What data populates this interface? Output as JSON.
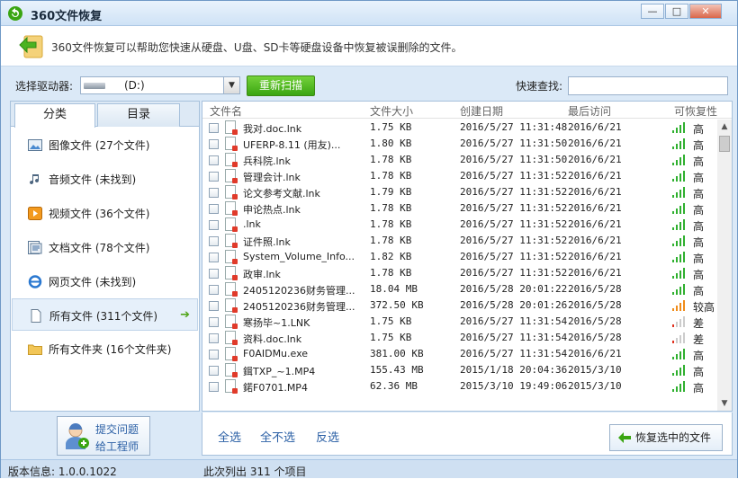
{
  "window": {
    "title": "360文件恢复",
    "min_label": "—",
    "max_label": "□",
    "close_label": "✕"
  },
  "banner": {
    "text": "360文件恢复可以帮助您快速从硬盘、U盘、SD卡等硬盘设备中恢复被误删除的文件。"
  },
  "toolbar": {
    "drive_label": "选择驱动器:",
    "drive_value": "(D:)",
    "scan_label": "重新扫描",
    "search_label": "快速查找:",
    "search_value": ""
  },
  "tabs": [
    {
      "label": "分类",
      "active": true
    },
    {
      "label": "目录",
      "active": false
    }
  ],
  "categories": [
    {
      "label": "图像文件 (27个文件)",
      "icon": "image-icon"
    },
    {
      "label": "音频文件 (未找到)",
      "icon": "music-icon"
    },
    {
      "label": "视频文件 (36个文件)",
      "icon": "video-icon"
    },
    {
      "label": "文档文件 (78个文件)",
      "icon": "document-icon"
    },
    {
      "label": "网页文件 (未找到)",
      "icon": "ie-icon"
    },
    {
      "label": "所有文件 (311个文件)",
      "icon": "file-icon",
      "active": true
    },
    {
      "label": "所有文件夹 (16个文件夹)",
      "icon": "folder-icon"
    }
  ],
  "help": {
    "line1": "提交问题",
    "line2": "给工程师"
  },
  "table": {
    "headers": {
      "name": "文件名",
      "size": "文件大小",
      "created": "创建日期",
      "accessed": "最后访问",
      "recover": "可恢复性"
    },
    "rows": [
      {
        "name": "我对.doc.lnk",
        "size": "1.75 KB",
        "created": "2016/5/27 11:31:48",
        "accessed": "2016/6/21",
        "recover": "高",
        "level": "high"
      },
      {
        "name": "UFERP-8.11 (用友)...",
        "size": "1.80 KB",
        "created": "2016/5/27 11:31:50",
        "accessed": "2016/6/21",
        "recover": "高",
        "level": "high"
      },
      {
        "name": "兵科院.lnk",
        "size": "1.78 KB",
        "created": "2016/5/27 11:31:50",
        "accessed": "2016/6/21",
        "recover": "高",
        "level": "high"
      },
      {
        "name": "管理会计.lnk",
        "size": "1.78 KB",
        "created": "2016/5/27 11:31:52",
        "accessed": "2016/6/21",
        "recover": "高",
        "level": "high"
      },
      {
        "name": "论文参考文献.lnk",
        "size": "1.79 KB",
        "created": "2016/5/27 11:31:52",
        "accessed": "2016/6/21",
        "recover": "高",
        "level": "high"
      },
      {
        "name": "申论热点.lnk",
        "size": "1.78 KB",
        "created": "2016/5/27 11:31:52",
        "accessed": "2016/6/21",
        "recover": "高",
        "level": "high"
      },
      {
        "name": "          .lnk",
        "size": "1.78 KB",
        "created": "2016/5/27 11:31:52",
        "accessed": "2016/6/21",
        "recover": "高",
        "level": "high"
      },
      {
        "name": "证件照.lnk",
        "size": "1.78 KB",
        "created": "2016/5/27 11:31:52",
        "accessed": "2016/6/21",
        "recover": "高",
        "level": "high"
      },
      {
        "name": "System_Volume_Info...",
        "size": "1.82 KB",
        "created": "2016/5/27 11:31:52",
        "accessed": "2016/6/21",
        "recover": "高",
        "level": "high"
      },
      {
        "name": "政审.lnk",
        "size": "1.78 KB",
        "created": "2016/5/27 11:31:52",
        "accessed": "2016/6/21",
        "recover": "高",
        "level": "high"
      },
      {
        "name": "2405120236财务管理...",
        "size": "18.04 MB",
        "created": "2016/5/28 20:01:22",
        "accessed": "2016/5/28",
        "recover": "高",
        "level": "high"
      },
      {
        "name": "2405120236财务管理...",
        "size": "372.50 KB",
        "created": "2016/5/28 20:01:26",
        "accessed": "2016/5/28",
        "recover": "较高",
        "level": "mid"
      },
      {
        "name": "寒扬毕~1.LNK",
        "size": "1.75 KB",
        "created": "2016/5/27 11:31:54",
        "accessed": "2016/5/28",
        "recover": "差",
        "level": "low"
      },
      {
        "name": "     资料.doc.lnk",
        "size": "1.75 KB",
        "created": "2016/5/27 11:31:54",
        "accessed": "2016/5/28",
        "recover": "差",
        "level": "low"
      },
      {
        "name": "F0AIDMu.exe",
        "size": "381.00 KB",
        "created": "2016/5/27 11:31:54",
        "accessed": "2016/6/21",
        "recover": "高",
        "level": "high"
      },
      {
        "name": "鍓TXP_~1.MP4",
        "size": "155.43 MB",
        "created": "2015/1/18 20:04:36",
        "accessed": "2015/3/10",
        "recover": "高",
        "level": "high"
      },
      {
        "name": "鍩F0701.MP4",
        "size": "62.36 MB",
        "created": "2015/3/10 19:49:06",
        "accessed": "2015/3/10",
        "recover": "高",
        "level": "high"
      }
    ]
  },
  "actions": {
    "select_all": "全选",
    "select_none": "全不选",
    "invert": "反选",
    "recover": "恢复选中的文件"
  },
  "status": {
    "version": "版本信息: 1.0.0.1022",
    "summary": "此次列出 311 个项目"
  },
  "colors": {
    "accent_green": "#3aa512",
    "link_blue": "#2a5fa5",
    "high": "#2fb02f",
    "mid": "#f08c1a",
    "low": "#e0301e"
  }
}
